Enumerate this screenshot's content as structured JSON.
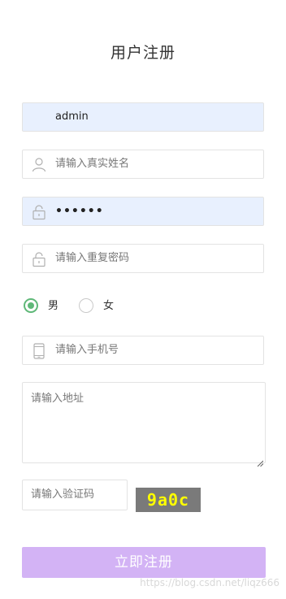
{
  "page": {
    "title": "用户注册"
  },
  "form": {
    "username": {
      "value": "admin"
    },
    "realname": {
      "placeholder": "请输入真实姓名"
    },
    "password": {
      "value": "••••••"
    },
    "repeat_password": {
      "placeholder": "请输入重复密码"
    },
    "gender": {
      "options": [
        {
          "label": "男",
          "checked": true
        },
        {
          "label": "女",
          "checked": false
        }
      ]
    },
    "phone": {
      "placeholder": "请输入手机号"
    },
    "address": {
      "placeholder": "请输入地址"
    },
    "captcha": {
      "placeholder": "请输入验证码",
      "code": "9a0c"
    },
    "submit_label": "立即注册"
  },
  "colors": {
    "accent_green": "#5fb878",
    "autofill_bg": "#e8f0fe",
    "submit_bg": "#d3b3f5",
    "captcha_bg": "#7a7a7a",
    "captcha_text": "#ffff00"
  },
  "icons": {
    "realname": "user-icon",
    "password": "lock-icon",
    "repeat_password": "lock-icon",
    "phone": "cellphone-icon"
  },
  "watermark": "https://blog.csdn.net/liqz666"
}
